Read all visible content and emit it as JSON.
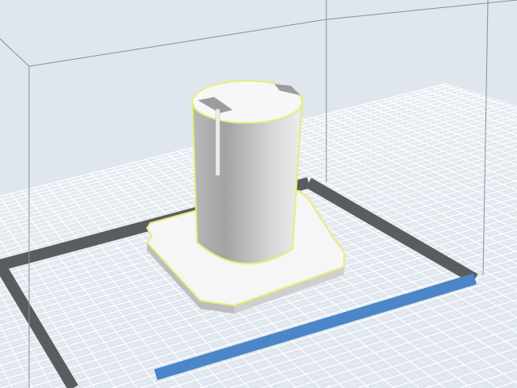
{
  "viewport": {
    "colors": {
      "background": "#dfe6ee",
      "grid_line": "#ffffff",
      "grid_minor": "#eef2f6",
      "build_border": "#5a5d60",
      "front_edge": "#4a86c8",
      "volume_edge": "#8a9096",
      "model_highlight": "#e8ec7a",
      "model_light": "#f4f4f4",
      "model_shadow": "#9a9a9a"
    },
    "grid_divisions": 24
  }
}
